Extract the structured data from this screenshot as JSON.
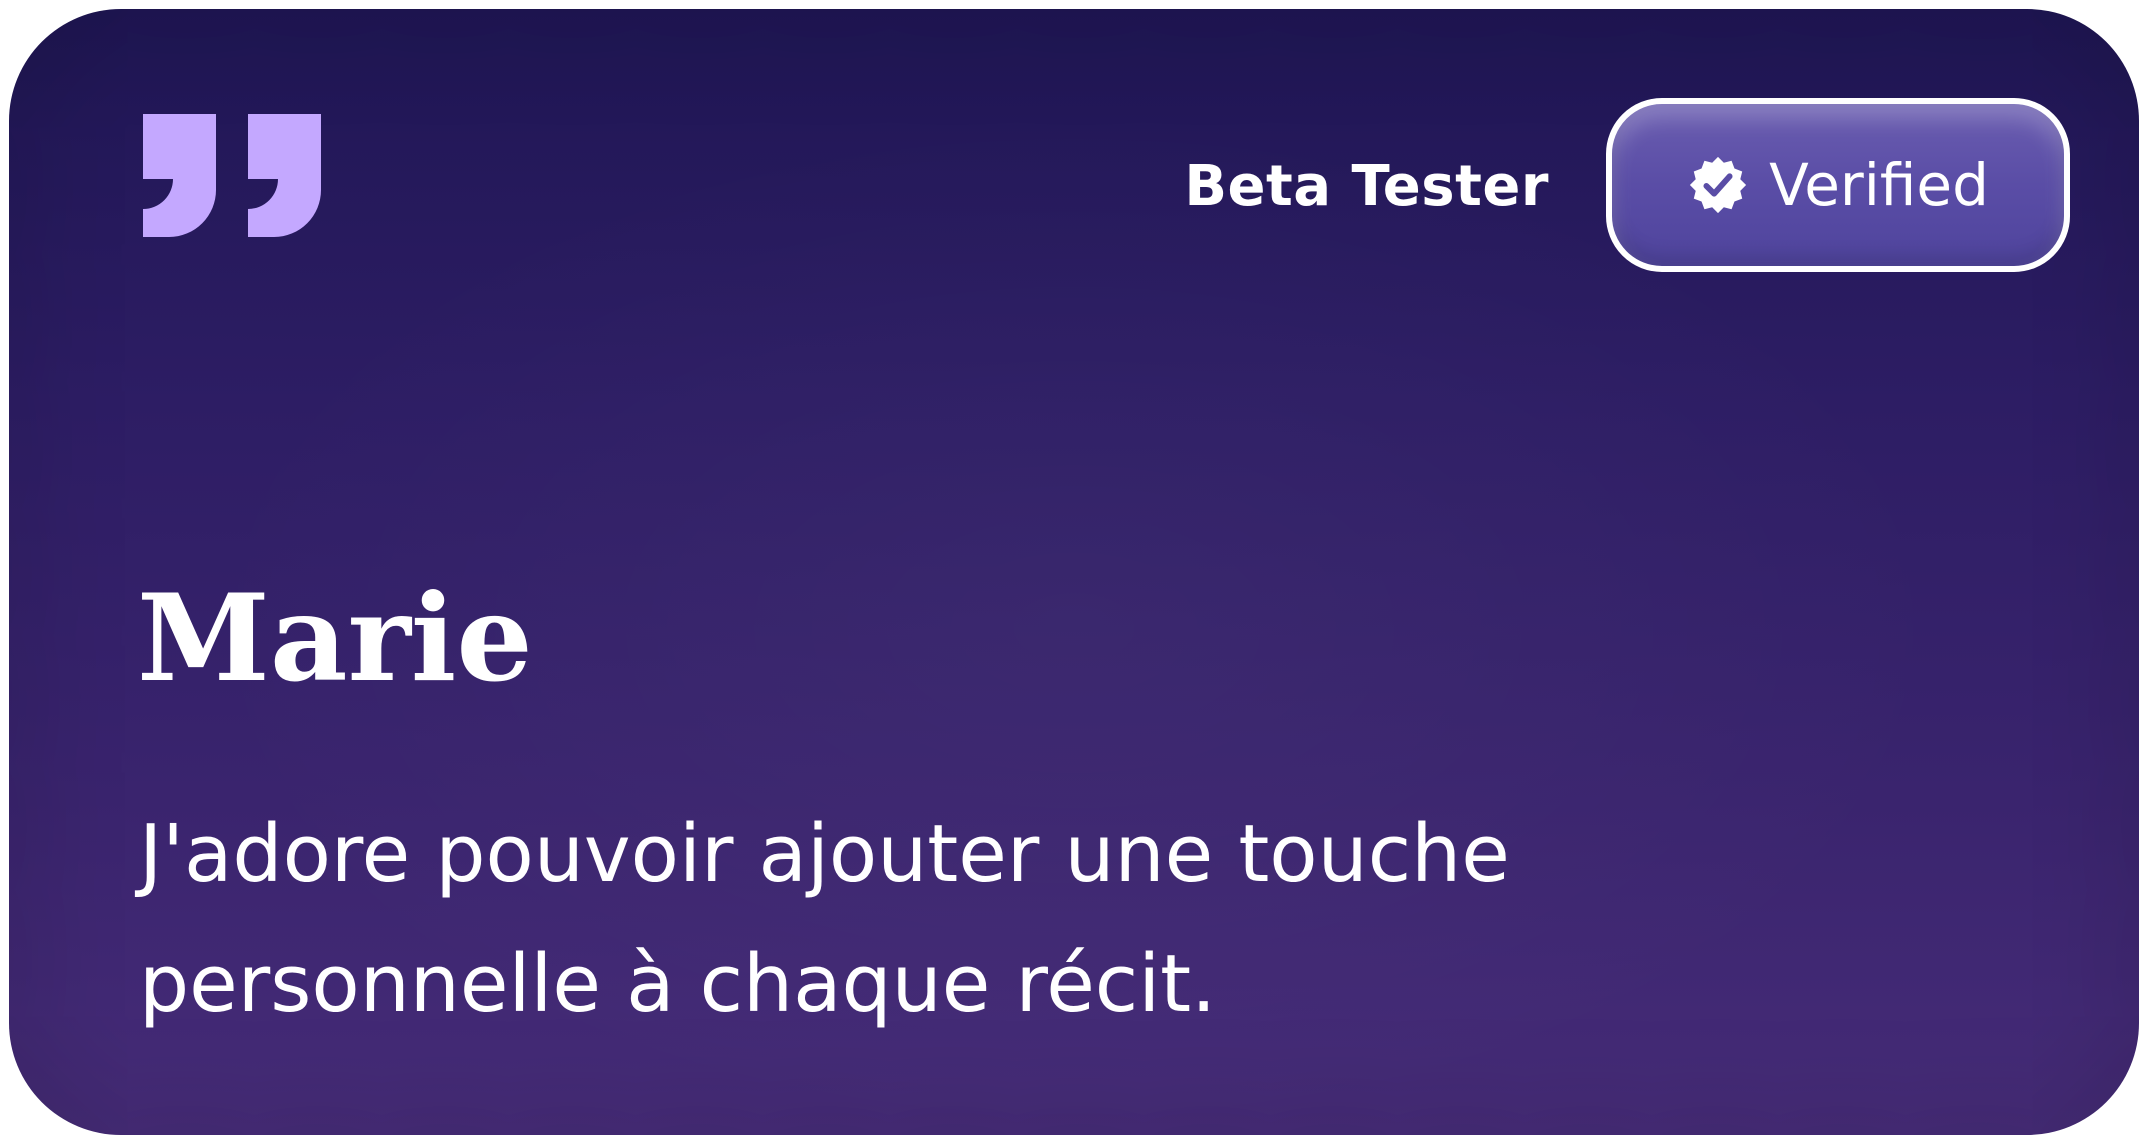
{
  "card": {
    "accent_color": "#c4a8ff",
    "quote_icon": "quote-icon"
  },
  "badge": {
    "label": "Beta Tester",
    "verified_label": "Verified",
    "verified_icon": "verified-badge-icon"
  },
  "testimonial": {
    "name": "Marie",
    "text": "J'adore pouvoir ajouter une touche personnelle à chaque récit."
  }
}
